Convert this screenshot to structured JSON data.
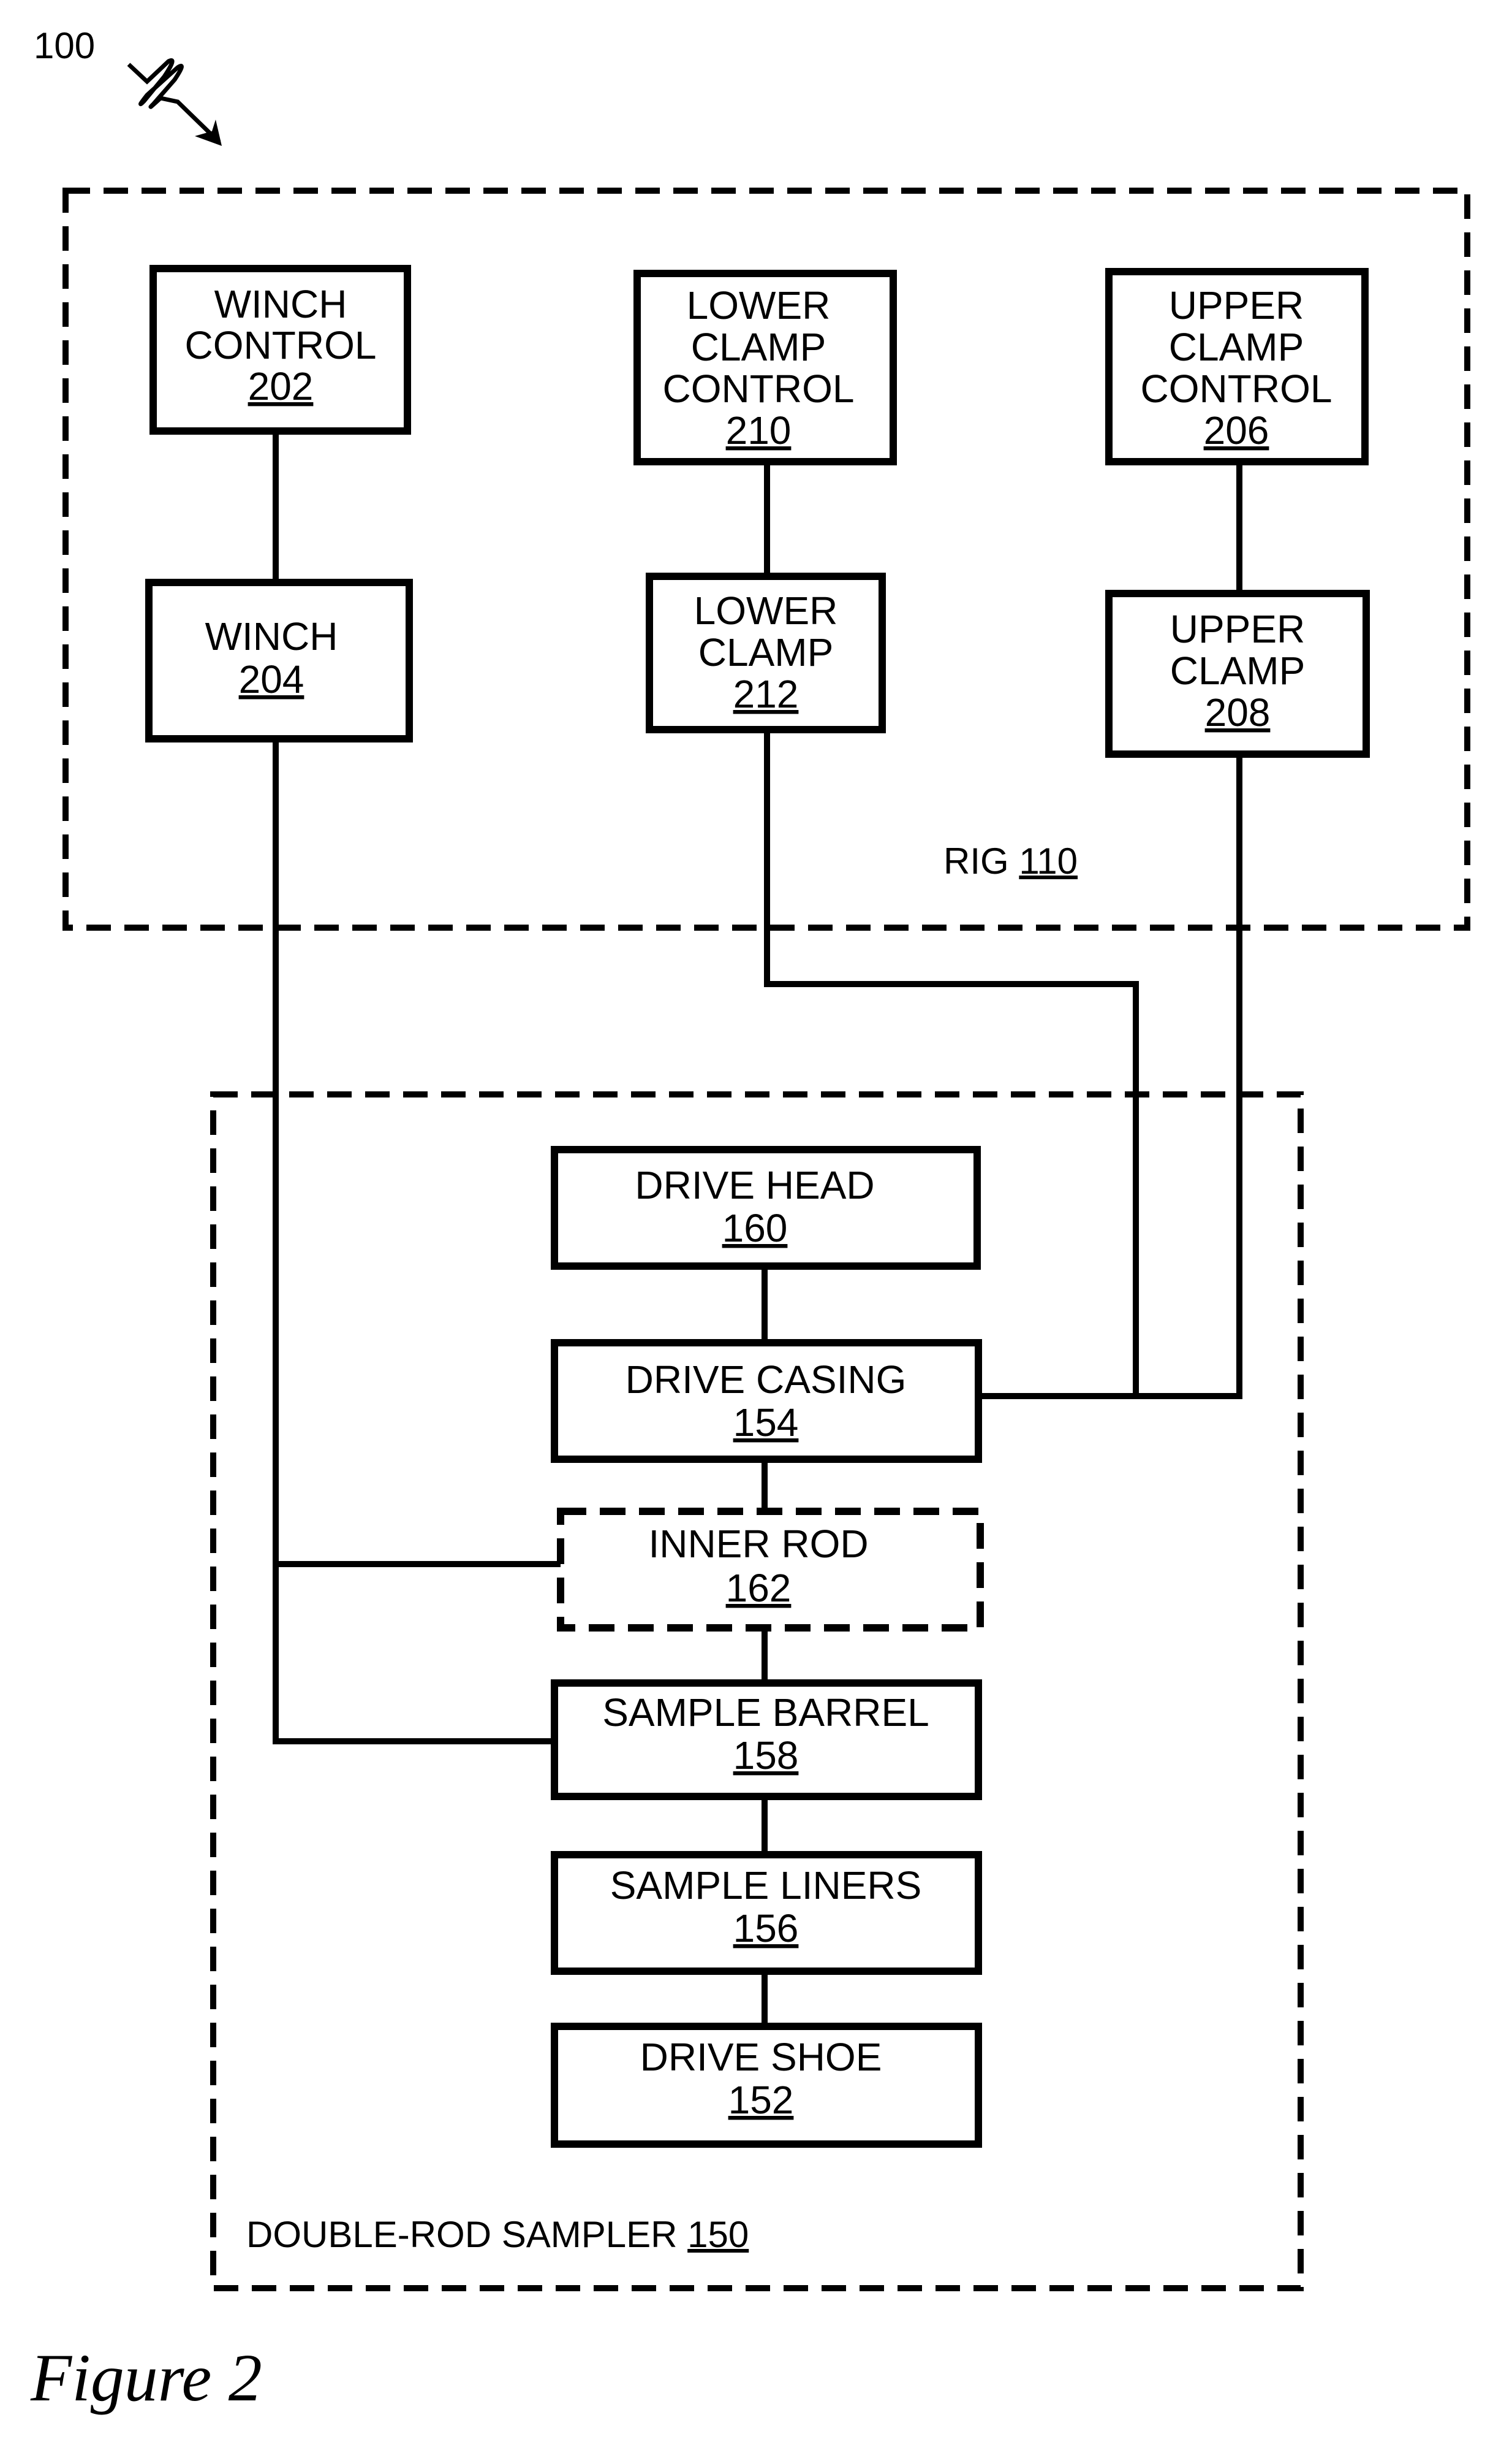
{
  "figure_ref": "100",
  "caption": "Figure 2",
  "groups": {
    "rig": {
      "label": "RIG",
      "number": "110"
    },
    "sampler": {
      "label": "DOUBLE-ROD SAMPLER",
      "number": "150"
    }
  },
  "blocks": {
    "winch_control": {
      "lines": [
        "WINCH",
        "CONTROL"
      ],
      "number": "202"
    },
    "winch": {
      "lines": [
        "WINCH"
      ],
      "number": "204"
    },
    "lower_clamp_control": {
      "lines": [
        "LOWER",
        "CLAMP",
        "CONTROL"
      ],
      "number": "210"
    },
    "lower_clamp": {
      "lines": [
        "LOWER",
        "CLAMP"
      ],
      "number": "212"
    },
    "upper_clamp_control": {
      "lines": [
        "UPPER",
        "CLAMP",
        "CONTROL"
      ],
      "number": "206"
    },
    "upper_clamp": {
      "lines": [
        "UPPER",
        "CLAMP"
      ],
      "number": "208"
    },
    "drive_head": {
      "lines": [
        "DRIVE HEAD"
      ],
      "number": "160"
    },
    "drive_casing": {
      "lines": [
        "DRIVE CASING"
      ],
      "number": "154"
    },
    "inner_rod": {
      "lines": [
        "INNER ROD"
      ],
      "number": "162"
    },
    "sample_barrel": {
      "lines": [
        "SAMPLE BARREL"
      ],
      "number": "158"
    },
    "sample_liners": {
      "lines": [
        "SAMPLE LINERS"
      ],
      "number": "156"
    },
    "drive_shoe": {
      "lines": [
        "DRIVE SHOE"
      ],
      "number": "152"
    }
  }
}
